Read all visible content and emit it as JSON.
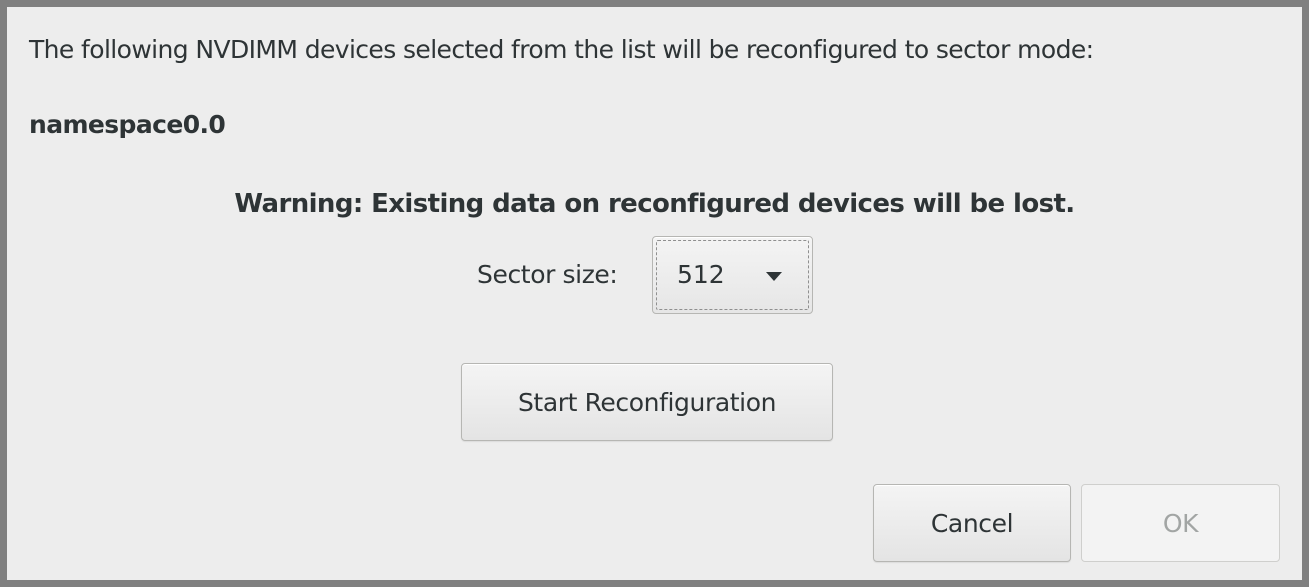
{
  "dialog": {
    "intro_text": "The following NVDIMM devices selected from the list will be reconfigured to sector mode:",
    "device_name": "namespace0.0",
    "warning_text": "Warning: Existing data on reconfigured devices will be lost.",
    "sector_size": {
      "label": "Sector size:",
      "selected_value": "512",
      "icon": "chevron-down-icon"
    },
    "start_button_label": "Start Reconfiguration",
    "cancel_button_label": "Cancel",
    "ok_button": {
      "label": "OK",
      "state": "disabled"
    }
  },
  "colors": {
    "background": "#ededed",
    "border": "#808080",
    "text": "#2e3436",
    "disabled_text": "#a2a5a4"
  }
}
